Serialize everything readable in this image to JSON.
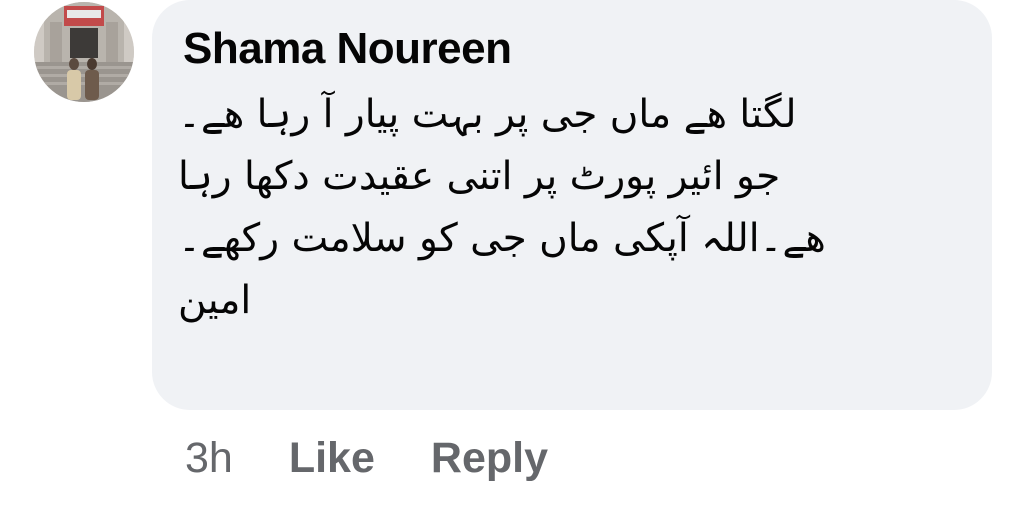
{
  "comment": {
    "author": "Shama Noureen",
    "text_lines": [
      "لگتا ھے ماں جی پر بہت پیار آ رہا ھے۔",
      "جو ائیر پورٹ پر اتنی عقیدت دکھا رہا",
      "ھے۔اللہ آپکی ماں جی کو سلامت رکھے۔",
      "امین"
    ],
    "timestamp": "3h",
    "like_label": "Like",
    "reply_label": "Reply"
  },
  "colors": {
    "bubble_background": "#f0f2f5",
    "author_text": "#050505",
    "meta_text": "#65676b"
  },
  "icons": {
    "avatar": "profile-photo"
  }
}
